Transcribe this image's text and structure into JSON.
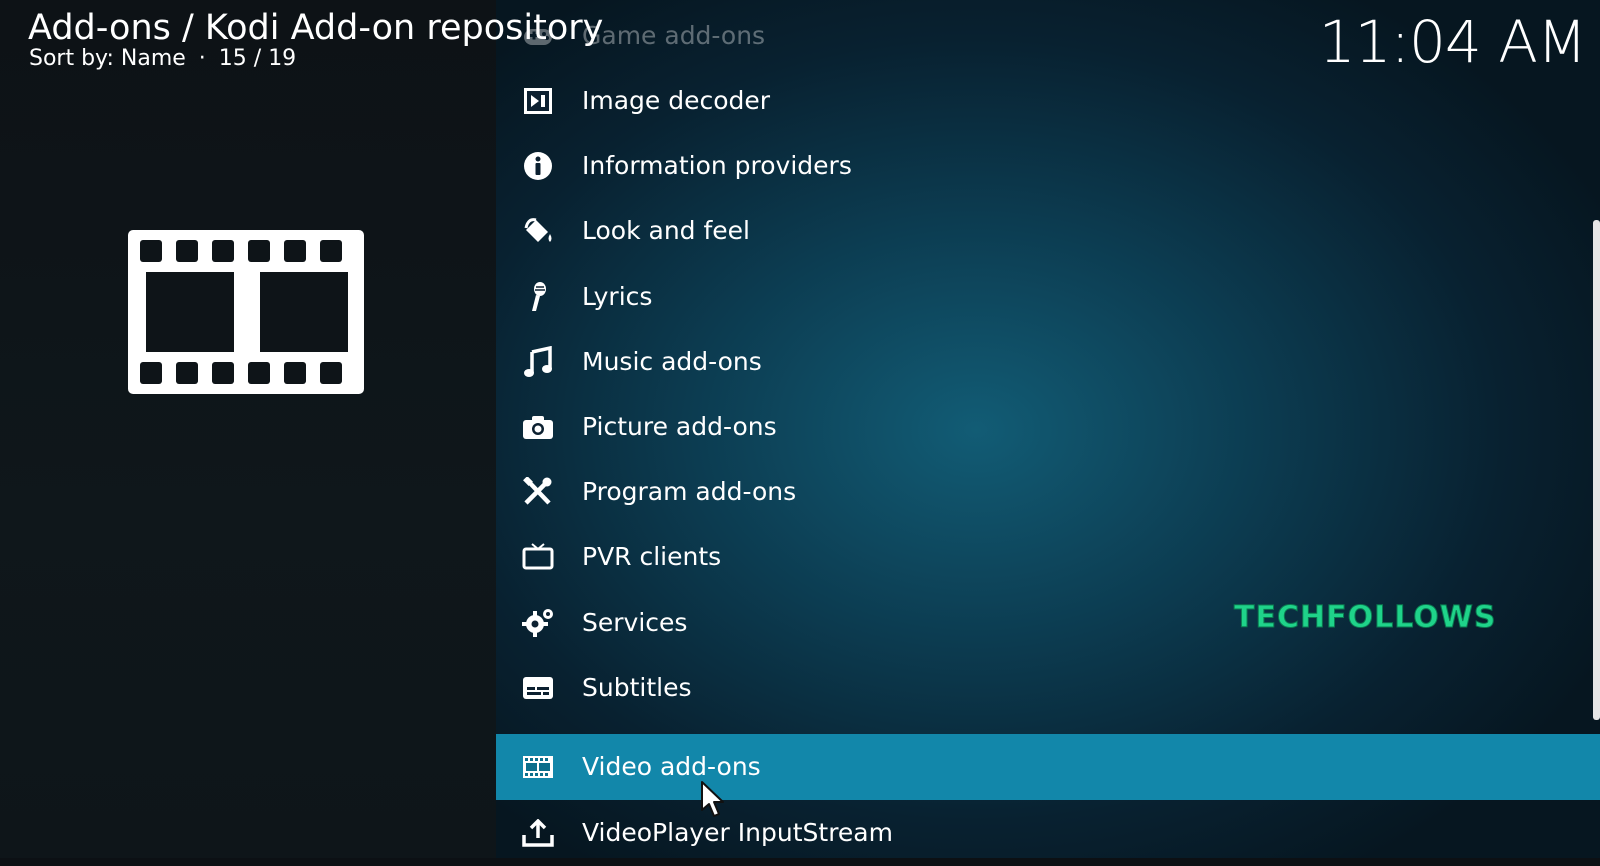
{
  "header": {
    "breadcrumb": "Add-ons / Kodi Add-on repository",
    "sort": "Sort by: Name",
    "separator": "·",
    "position": "15 / 19"
  },
  "clock": "11:04 AM",
  "categories": [
    {
      "label": "Game add-ons",
      "icon": "game-icon"
    },
    {
      "label": "Image decoder",
      "icon": "image-decoder-icon"
    },
    {
      "label": "Information providers",
      "icon": "info-icon"
    },
    {
      "label": "Look and feel",
      "icon": "paint-bucket-icon"
    },
    {
      "label": "Lyrics",
      "icon": "microphone-icon"
    },
    {
      "label": "Music add-ons",
      "icon": "music-note-icon"
    },
    {
      "label": "Picture add-ons",
      "icon": "camera-icon"
    },
    {
      "label": "Program add-ons",
      "icon": "tools-icon"
    },
    {
      "label": "PVR clients",
      "icon": "tv-icon"
    },
    {
      "label": "Services",
      "icon": "gears-icon"
    },
    {
      "label": "Subtitles",
      "icon": "subtitles-icon"
    },
    {
      "label": "Video add-ons",
      "icon": "film-icon"
    },
    {
      "label": "VideoPlayer InputStream",
      "icon": "upload-tray-icon"
    }
  ],
  "focused_index": 11,
  "watermark": "TECHFOLLOWS",
  "colors": {
    "focus": "#1287aa",
    "watermark": "#1fd38a"
  }
}
